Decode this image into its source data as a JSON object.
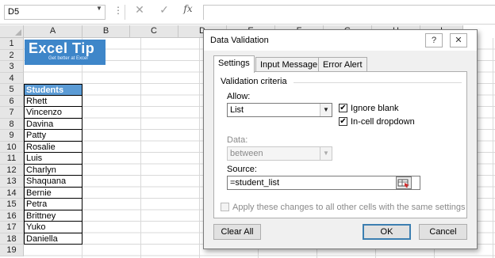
{
  "formula_bar": {
    "name_box": "D5",
    "dots": "⋮",
    "cancel_glyph": "✕",
    "enter_glyph": "✓",
    "fx_label": "fx",
    "formula": ""
  },
  "columns": [
    "A",
    "B",
    "C",
    "D",
    "E",
    "F",
    "G",
    "H",
    "I"
  ],
  "rows": [
    "1",
    "2",
    "3",
    "4",
    "5",
    "6",
    "7",
    "8",
    "9",
    "10",
    "11",
    "12",
    "13",
    "14",
    "15",
    "16",
    "17",
    "18",
    "19"
  ],
  "logo": {
    "brand": "Excel Tip",
    "tagline": "Get better at Excel"
  },
  "sheet": {
    "header": "Students",
    "names": [
      "Rhett",
      "Vincenzo",
      "Davina",
      "Patty",
      "Rosalie",
      "Luis",
      "Charlyn",
      "Shaquana",
      "Bernie",
      "Petra",
      "Brittney",
      "Yuko",
      "Daniella"
    ]
  },
  "dialog": {
    "title": "Data Validation",
    "help_glyph": "?",
    "close_glyph": "✕",
    "tabs": [
      "Settings",
      "Input Message",
      "Error Alert"
    ],
    "active_tab": "Settings",
    "group_label": "Validation criteria",
    "allow_label": "Allow:",
    "allow_value": "List",
    "ignore_blank_label": "Ignore blank",
    "ignore_blank_checked": true,
    "incell_dropdown_label": "In-cell dropdown",
    "incell_dropdown_checked": true,
    "data_label": "Data:",
    "data_value": "between",
    "source_label": "Source:",
    "source_value": "=student_list",
    "apply_all_label": "Apply these changes to all other cells with the same settings",
    "apply_all_checked": false,
    "clear_all": "Clear All",
    "ok": "OK",
    "cancel": "Cancel"
  },
  "colors": {
    "header_fill": "#5b9bd5",
    "logo_bg": "#3e86c9",
    "default_button_border": "#3c7fb1"
  }
}
